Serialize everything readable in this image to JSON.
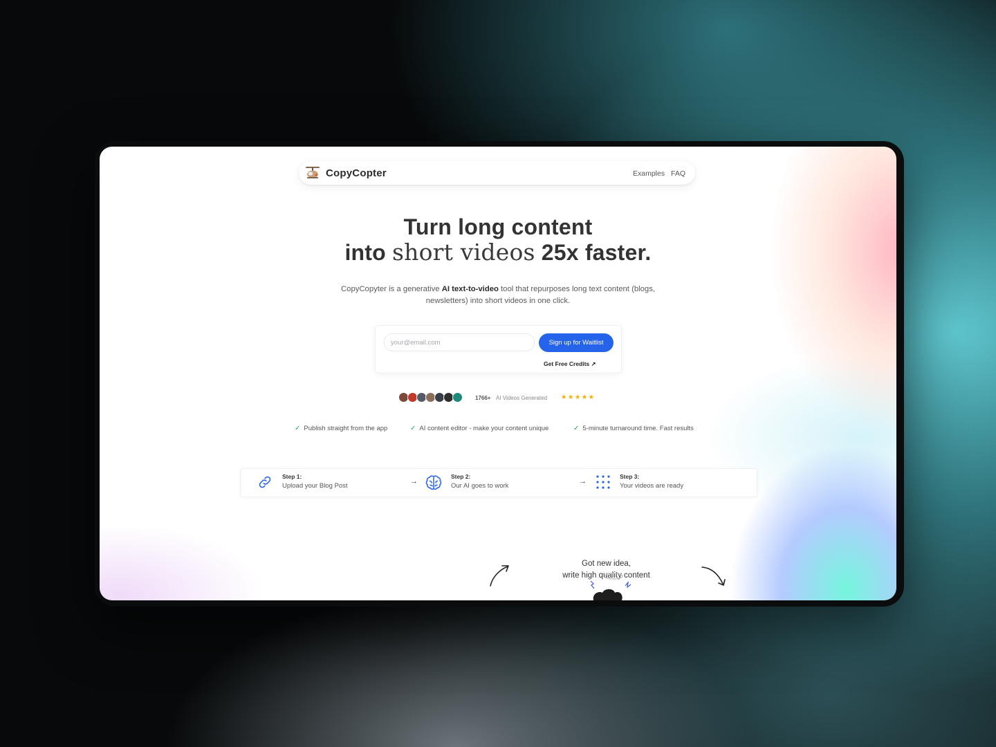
{
  "brand": {
    "name": "CopyCopter"
  },
  "nav": {
    "links": [
      "Examples",
      "FAQ"
    ]
  },
  "hero": {
    "line1": "Turn long content",
    "line2_part1": "into",
    "line2_serif": "short videos",
    "line2_part2": "25x faster."
  },
  "subtitle": {
    "part1": "CopyCopyter is a generative ",
    "bold": "AI text-to-video",
    "part2": " tool that repurposes long text content (blogs, newsletters) into short videos in one click."
  },
  "form": {
    "email_placeholder": "your@email.com",
    "submit_label": "Sign up for Waitlist",
    "free_credits_label": "Get Free Credits",
    "free_credits_arrow": "↗"
  },
  "social_proof": {
    "count": "1766+",
    "label": "AI Videos Generated",
    "stars": "★★★★★",
    "avatar_colors": [
      "#7a4b3a",
      "#c0392b",
      "#555b66",
      "#8a6e5a",
      "#3a3f47",
      "#2f2f2f",
      "#1e8a7a"
    ]
  },
  "features": [
    "Publish straight from the app",
    "AI content editor - make your content unique",
    "5-minute turnaround time. Fast results"
  ],
  "steps": [
    {
      "title": "Step 1:",
      "text": "Upload your Blog Post",
      "icon": "link-icon"
    },
    {
      "title": "Step 2:",
      "text": "Our AI goes to work",
      "icon": "brain-icon"
    },
    {
      "title": "Step 3:",
      "text": "Your videos are ready",
      "icon": "grid-dots-icon"
    }
  ],
  "step_arrow": "→",
  "illustration": {
    "line1": "Got new idea,",
    "line2": "write high quality content"
  },
  "colors": {
    "accent": "#2563eb",
    "check": "#22a55a",
    "star": "#f5b100",
    "text": "#333333"
  }
}
